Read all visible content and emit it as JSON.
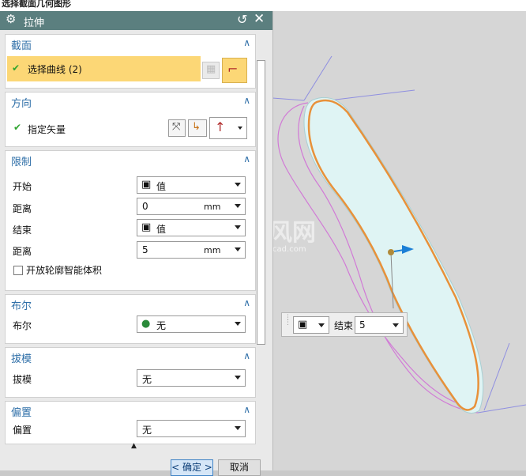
{
  "window_caption": "选择截面几何图形",
  "dialog": {
    "title": "拉伸"
  },
  "section": {
    "header": "截面",
    "select_curve_label": "选择曲线 (2)"
  },
  "direction": {
    "header": "方向",
    "specify_vector_label": "指定矢量"
  },
  "limits": {
    "header": "限制",
    "start_label": "开始",
    "start_value": "值",
    "start_distance_label": "距离",
    "start_distance_value": "0",
    "start_unit": "mm",
    "end_label": "结束",
    "end_value": "值",
    "end_distance_label": "距离",
    "end_distance_value": "5",
    "end_unit": "mm",
    "open_profile_label": "开放轮廓智能体积"
  },
  "boolean": {
    "header": "布尔",
    "label": "布尔",
    "value": "无"
  },
  "draft": {
    "header": "拔模",
    "label": "拔模",
    "value": "无"
  },
  "offset": {
    "header": "偏置",
    "label": "偏置",
    "value": "无"
  },
  "buttons": {
    "ok": "< 确定 >",
    "cancel": "取消"
  },
  "float_bar": {
    "end_label": "结束",
    "end_value": "5"
  },
  "watermark": {
    "main": "沐风网",
    "sub": "www.mfcad.com"
  },
  "colors": {
    "title_bar": "#5b7f7f",
    "section_header": "#2f6fa8",
    "selection_highlight": "#fcd776",
    "check_green": "#2fa52f",
    "profile_orange": "#e8913a",
    "curve_magenta": "#d17ad6",
    "axis_blue": "#8f8fe0",
    "vector_blue": "#1b7fd6"
  },
  "icons": [
    "gear-icon",
    "reset-icon",
    "close-icon",
    "check-icon",
    "cube-icon",
    "boolean-none-icon",
    "vector-icon",
    "reverse-direction-icon"
  ]
}
